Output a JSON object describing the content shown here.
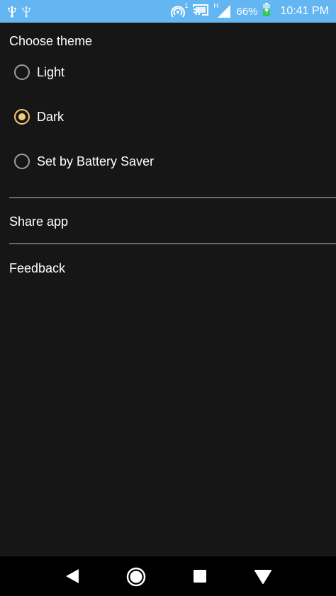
{
  "status_bar": {
    "icons": [
      "usb-icon",
      "usb-debug-icon",
      "hotspot-icon",
      "cast-icon",
      "signal-icon",
      "battery-charging-icon"
    ],
    "hotspot_badge": "1",
    "signal_type": "H",
    "battery_percent": "66%",
    "time": "10:41 PM",
    "background_color": "#64b6f2"
  },
  "theme": {
    "title": "Choose theme",
    "options": [
      {
        "label": "Light",
        "selected": false
      },
      {
        "label": "Dark",
        "selected": true
      },
      {
        "label": "Set by Battery Saver",
        "selected": false
      }
    ],
    "accent_color": "#f7c971"
  },
  "menu": {
    "share_label": "Share app",
    "feedback_label": "Feedback"
  },
  "nav_bar": {
    "buttons": [
      "back-icon",
      "home-icon",
      "recents-icon",
      "assistant-icon"
    ]
  }
}
